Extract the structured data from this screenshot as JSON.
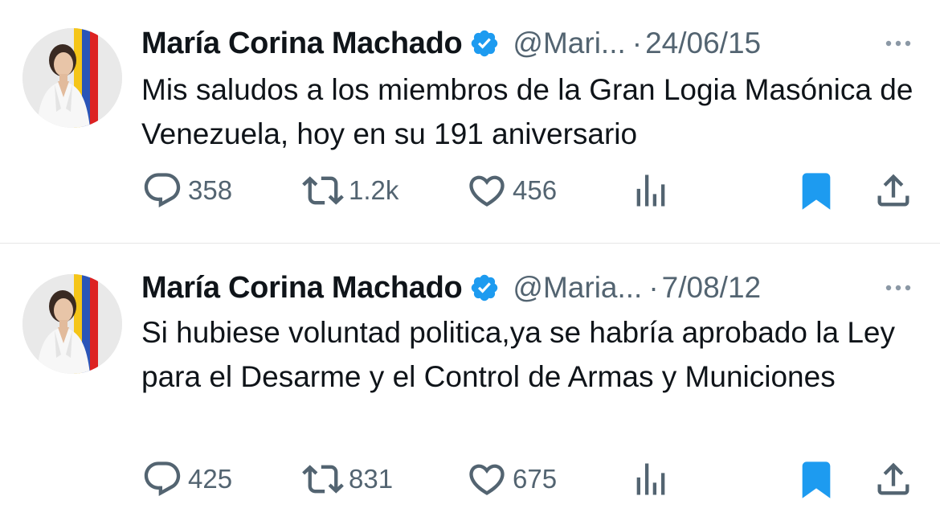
{
  "tweets": [
    {
      "author_name": "María Corina Machado",
      "handle": "@Mari...",
      "separator": "·",
      "date": "24/06/15",
      "text": "Mis saludos a los miembros de la Gran Logia Masónica de Venezuela, hoy en su 191 aniversario",
      "replies": "358",
      "retweets": "1.2k",
      "likes": "456",
      "bookmarked": true
    },
    {
      "author_name": "María Corina Machado",
      "handle": "@Maria...",
      "separator": "·",
      "date": "7/08/12",
      "text": "Si hubiese voluntad politica,ya se habría aprobado la Ley para el Desarme y el Control de Armas y Municiones",
      "replies": "425",
      "retweets": "831",
      "likes": "675",
      "bookmarked": true
    }
  ],
  "colors": {
    "verified_badge": "#1d9bf0",
    "bookmark_active": "#1d9bf0",
    "secondary_text": "#536471",
    "primary_text": "#0f1419"
  },
  "icons": [
    "reply-icon",
    "retweet-icon",
    "like-icon",
    "views-icon",
    "bookmark-icon",
    "share-icon",
    "verified-badge-icon",
    "more-icon"
  ]
}
